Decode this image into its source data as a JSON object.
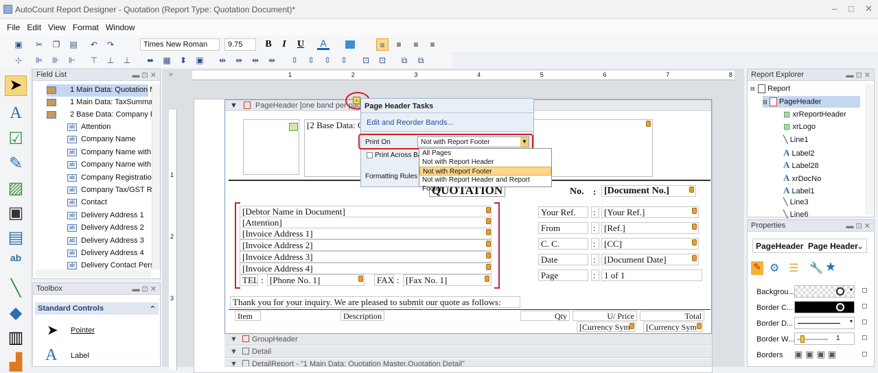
{
  "window": {
    "title": "AutoCount Report Designer - Quotation (Report Type: Quotation Document)*",
    "min": "–",
    "max": "□",
    "close": "✕"
  },
  "menu": [
    "File",
    "Edit",
    "View",
    "Format",
    "Window"
  ],
  "toolbar": {
    "font_name": "Times New Roman",
    "font_size": "9.75",
    "bold": "B",
    "italic": "I",
    "underline": "U",
    "font_color": "A"
  },
  "field_list": {
    "title": "Field List",
    "tree": [
      "1 Main Data:  Quotation M",
      "1 Main Data:  TaxSummar",
      "2 Base Data:  Company Pr"
    ],
    "fields": [
      "Attention",
      "Company Name",
      "Company Name with R",
      "Company Name with R",
      "Company Registration",
      "Company Tax/GST Re",
      "Contact",
      "Delivery Address 1",
      "Delivery Address 2",
      "Delivery Address 3",
      "Delivery Address 4",
      "Delivery Contact Perso"
    ],
    "field_icon": "ab"
  },
  "toolbox": {
    "title": "Toolbox",
    "group": "Standard Controls",
    "items": [
      {
        "label": "Pointer"
      },
      {
        "label": "Label"
      }
    ]
  },
  "report": {
    "band_header": "PageHeader [one band per page]",
    "base_data": "[2 Base Data:  C",
    "quotation_title": "QUOTATION",
    "no_label": "No.",
    "colon": ":",
    "doc_no": "[Document No.]",
    "debtor": "[Debtor Name in Document]",
    "attention": "[Attention]",
    "addr1": "[Invoice Address 1]",
    "addr2": "[Invoice Address 2]",
    "addr3": "[Invoice Address 3]",
    "addr4": "[Invoice Address 4]",
    "tel_label": "TEL",
    "phone": "[Phone No. 1]",
    "fax_label": "FAX",
    "fax": "[Fax No. 1]",
    "your_ref_label": "Your Ref.",
    "your_ref": "[Your Ref.]",
    "from_label": "From",
    "from": "[Ref.]",
    "cc_label": "C. C.",
    "cc": "[CC]",
    "date_label": "Date",
    "date": "[Document Date]",
    "page_label": "Page",
    "page": "1 of 1",
    "thanks": "Thank you for your inquiry. We are pleased to submit our quote as follows:",
    "col_item": "Item",
    "col_desc": "Description",
    "col_qty": "Qty",
    "col_price": "U/ Price",
    "col_total": "Total",
    "currency1": "[Currency Sym",
    "currency2": "[Currency Sym",
    "bands": [
      "GroupHeader",
      "Detail",
      "DetailReport - \"1 Main Data:  Quotation Master.Quotation Detail\""
    ]
  },
  "tasks": {
    "title": "Page Header Tasks",
    "link": "Edit and Reorder Bands...",
    "print_on_label": "Print On",
    "print_on_value": "Not with Report Footer",
    "print_across": "Print Across Ba",
    "formatting_rules": "Formatting Rules",
    "options": [
      "All Pages",
      "Not with Report Header",
      "Not with Report Footer",
      "Not with Report Header and Report Footer"
    ],
    "selected_index": 2
  },
  "ruler": [
    "1",
    "2",
    "3",
    "4",
    "5",
    "6",
    "7",
    "8"
  ],
  "vruler": [
    "1",
    "2",
    "3"
  ],
  "explorer": {
    "title": "Report Explorer",
    "root": "Report",
    "header": "PageHeader",
    "items": [
      "xrReportHeader",
      "xrLogo",
      "Line1",
      "Label2",
      "Label28",
      "xrDocNo",
      "Label1",
      "Line3",
      "Line6"
    ]
  },
  "properties": {
    "title": "Properties",
    "object_name": "PageHeader",
    "object_type": "Page Header",
    "rows": [
      "Backgrou...",
      "Border C...",
      "Border D...",
      "Border W...",
      "Borders"
    ],
    "border_width": "1"
  },
  "colors": {
    "selection": "#c5d7f0",
    "accent": "#f1c74a",
    "red_mark": "#d02020"
  }
}
